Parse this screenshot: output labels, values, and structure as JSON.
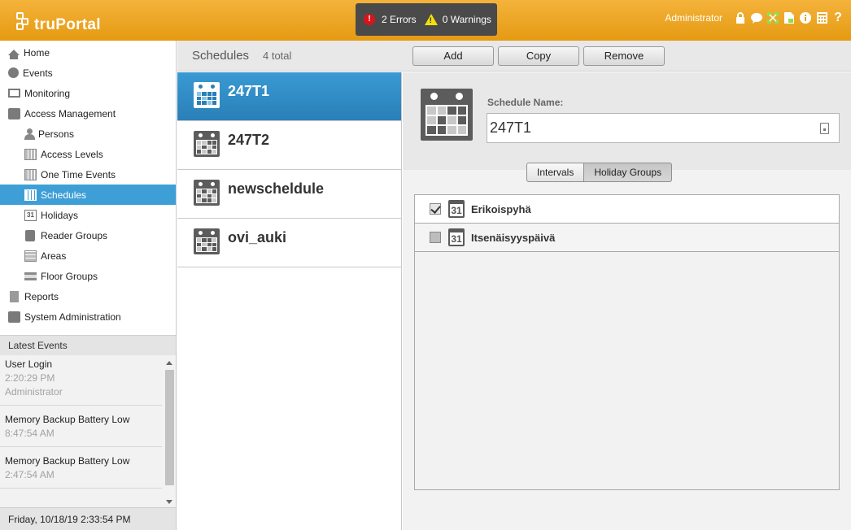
{
  "header": {
    "app_name": "truPortal",
    "errors_label": "2 Errors",
    "warnings_label": "0 Warnings",
    "user": "Administrator",
    "icons": [
      "lock-icon",
      "chat-icon",
      "network-icon",
      "report-icon",
      "info-icon",
      "calculator-icon",
      "help-icon"
    ]
  },
  "nav": {
    "items": [
      {
        "label": "Home",
        "icon": "home-icon"
      },
      {
        "label": "Events",
        "icon": "alert-icon"
      },
      {
        "label": "Monitoring",
        "icon": "monitor-icon"
      },
      {
        "label": "Access Management",
        "icon": "access-icon"
      },
      {
        "label": "Persons",
        "icon": "person-icon"
      },
      {
        "label": "Access Levels",
        "icon": "access-levels-icon"
      },
      {
        "label": "One Time Events",
        "icon": "one-time-events-icon"
      },
      {
        "label": "Schedules",
        "icon": "schedule-icon"
      },
      {
        "label": "Holidays",
        "icon": "holiday-icon"
      },
      {
        "label": "Reader Groups",
        "icon": "reader-groups-icon"
      },
      {
        "label": "Areas",
        "icon": "areas-icon"
      },
      {
        "label": "Floor Groups",
        "icon": "floor-groups-icon"
      },
      {
        "label": "Reports",
        "icon": "reports-icon"
      },
      {
        "label": "System Administration",
        "icon": "system-admin-icon"
      }
    ]
  },
  "latest_events": {
    "title": "Latest Events",
    "events": [
      {
        "title": "User Login",
        "time": "2:20:29 PM",
        "user": "Administrator"
      },
      {
        "title": "Memory Backup Battery Low",
        "time": "8:47:54 AM"
      },
      {
        "title": "Memory Backup Battery Low",
        "time": "2:47:54 AM"
      }
    ]
  },
  "status_bar": {
    "datetime": "Friday, 10/18/19 2:33:54 PM"
  },
  "toolbar": {
    "title": "Schedules",
    "count": "4 total",
    "add_label": "Add",
    "copy_label": "Copy",
    "remove_label": "Remove"
  },
  "schedules": [
    {
      "name": "247T1",
      "selected": true
    },
    {
      "name": "247T2",
      "selected": false
    },
    {
      "name": "newscheldule",
      "selected": false
    },
    {
      "name": "ovi_auki",
      "selected": false
    }
  ],
  "detail": {
    "field_label": "Schedule Name:",
    "name_value": "247T1",
    "tabs": {
      "intervals": "Intervals",
      "holiday_groups": "Holiday Groups"
    },
    "holiday_icon_text": "31",
    "holiday_groups": [
      {
        "name": "Erikoispyhä",
        "checked": true
      },
      {
        "name": "Itsenäisyyspäivä",
        "checked": false
      }
    ]
  },
  "colors": {
    "header_orange": "#e9a21e",
    "accent_blue": "#3e9fd6",
    "error_red": "#d8141b",
    "warning_yellow": "#f2df0c"
  }
}
